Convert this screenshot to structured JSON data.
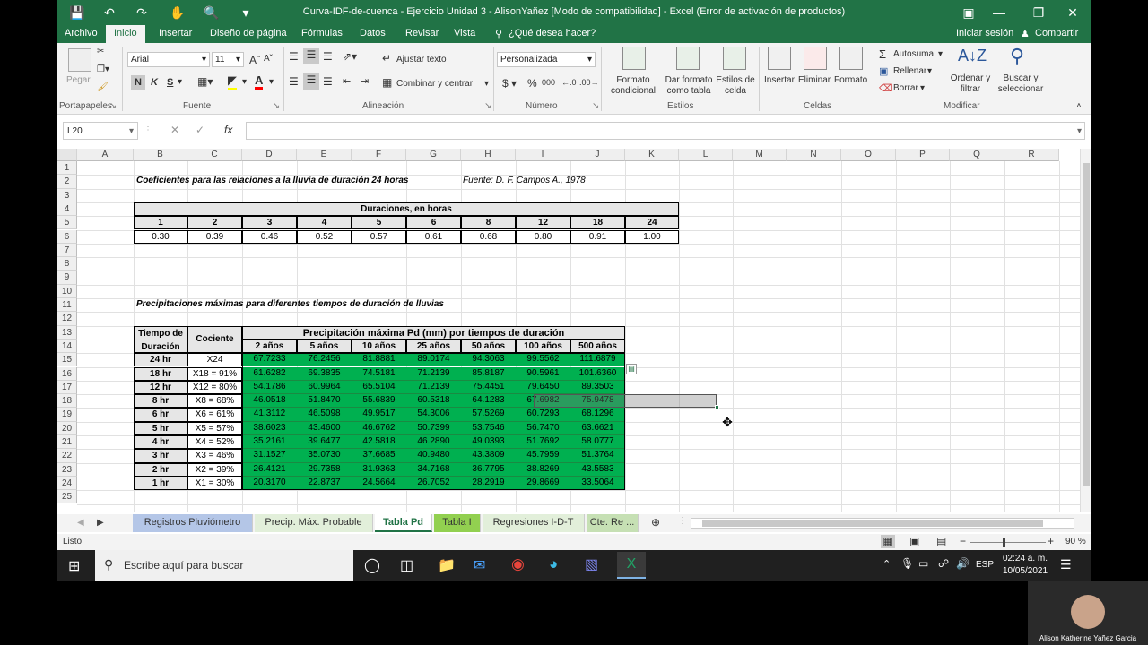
{
  "window": {
    "title": "Curva-IDF-de-cuenca - Ejercicio Unidad 3 - AlisonYañez  [Modo de compatibilidad] - Excel (Error de activación de productos)"
  },
  "ribbon_tabs": [
    "Archivo",
    "Inicio",
    "Insertar",
    "Diseño de página",
    "Fórmulas",
    "Datos",
    "Revisar",
    "Vista"
  ],
  "tell_me": "¿Qué desea hacer?",
  "account": {
    "signin": "Iniciar sesión",
    "share": "Compartir"
  },
  "ribbon": {
    "clipboard": {
      "paste": "Pegar",
      "label": "Portapapeles"
    },
    "font": {
      "name": "Arial",
      "size": "11",
      "bold": "N",
      "italic": "K",
      "underline": "S",
      "label": "Fuente"
    },
    "alignment": {
      "wrap": "Ajustar texto",
      "merge": "Combinar y centrar",
      "label": "Alineación"
    },
    "number": {
      "format": "Personalizada",
      "label": "Número"
    },
    "styles": {
      "conditional": "Formato condicional",
      "table": "Dar formato como tabla",
      "cell": "Estilos de celda",
      "label": "Estilos"
    },
    "cells": {
      "insert": "Insertar",
      "delete": "Eliminar",
      "format": "Formato",
      "label": "Celdas"
    },
    "editing": {
      "autosum": "Autosuma",
      "fill": "Rellenar",
      "clear": "Borrar",
      "sort": "Ordenar y filtrar",
      "find": "Buscar y seleccionar",
      "label": "Modificar"
    }
  },
  "namebox": "L20",
  "columns": [
    "A",
    "B",
    "C",
    "D",
    "E",
    "F",
    "G",
    "H",
    "I",
    "J",
    "K",
    "L",
    "M",
    "N",
    "O",
    "P",
    "Q",
    "R"
  ],
  "rows": [
    "1",
    "2",
    "3",
    "4",
    "5",
    "6",
    "7",
    "8",
    "9",
    "10",
    "11",
    "12",
    "13",
    "14",
    "15",
    "16",
    "17",
    "18",
    "19",
    "20",
    "21",
    "22",
    "23",
    "24",
    "25"
  ],
  "sheet": {
    "title1": "Coeficientes para las relaciones a la lluvia de duración 24 horas",
    "source": "Fuente: D. F. Campos A., 1978",
    "dur_header": "Duraciones, en horas",
    "durations": [
      "1",
      "2",
      "3",
      "4",
      "5",
      "6",
      "8",
      "12",
      "18",
      "24"
    ],
    "coefs": [
      "0.30",
      "0.39",
      "0.46",
      "0.52",
      "0.57",
      "0.61",
      "0.68",
      "0.80",
      "0.91",
      "1.00"
    ],
    "title2": "Precipitaciones máximas para diferentes tiempos de duración de lluvias",
    "h_tiempo": "Tiempo de Duración",
    "h_cociente": "Cociente",
    "h_precip": "Precipitación máxima Pd (mm) por tiempos de duración",
    "periods": [
      "2 años",
      "5 años",
      "10 años",
      "25 años",
      "50 años",
      "100 años",
      "500 años"
    ],
    "table": [
      {
        "t": "24 hr",
        "c": "X24",
        "v": [
          "67.7233",
          "76.2456",
          "81.8881",
          "89.0174",
          "94.3063",
          "99.5562",
          "111.6879"
        ]
      },
      {
        "t": "18 hr",
        "c": "X18 = 91%",
        "v": [
          "61.6282",
          "69.3835",
          "74.5181",
          "71.2139",
          "85.8187",
          "90.5961",
          "101.6360"
        ]
      },
      {
        "t": "12 hr",
        "c": "X12 = 80%",
        "v": [
          "54.1786",
          "60.9964",
          "65.5104",
          "71.2139",
          "75.4451",
          "79.6450",
          "89.3503"
        ]
      },
      {
        "t": "8 hr",
        "c": "X8 = 68%",
        "v": [
          "46.0518",
          "51.8470",
          "55.6839",
          "60.5318",
          "64.1283",
          "67.6982",
          "75.9478"
        ]
      },
      {
        "t": "6 hr",
        "c": "X6 = 61%",
        "v": [
          "41.3112",
          "46.5098",
          "49.9517",
          "54.3006",
          "57.5269",
          "60.7293",
          "68.1296"
        ]
      },
      {
        "t": "5 hr",
        "c": "X5 = 57%",
        "v": [
          "38.6023",
          "43.4600",
          "46.6762",
          "50.7399",
          "53.7546",
          "56.7470",
          "63.6621"
        ]
      },
      {
        "t": "4 hr",
        "c": "X4 = 52%",
        "v": [
          "35.2161",
          "39.6477",
          "42.5818",
          "46.2890",
          "49.0393",
          "51.7692",
          "58.0777"
        ]
      },
      {
        "t": "3 hr",
        "c": "X3 = 46%",
        "v": [
          "31.1527",
          "35.0730",
          "37.6685",
          "40.9480",
          "43.3809",
          "45.7959",
          "51.3764"
        ]
      },
      {
        "t": "2 hr",
        "c": "X2 = 39%",
        "v": [
          "26.4121",
          "29.7358",
          "31.9363",
          "34.7168",
          "36.7795",
          "38.8269",
          "43.5583"
        ]
      },
      {
        "t": "1 hr",
        "c": "X1 = 30%",
        "v": [
          "20.3170",
          "22.8737",
          "24.5664",
          "26.7052",
          "28.2919",
          "29.8669",
          "33.5064"
        ]
      }
    ]
  },
  "sheet_tabs": [
    {
      "name": "Registros Pluviómetro",
      "color": "#b4c6e7"
    },
    {
      "name": "Precip. Máx. Probable",
      "color": "#e2efda"
    },
    {
      "name": "Tabla Pd",
      "color": "#ffffff"
    },
    {
      "name": "Tabla I",
      "color": "#92d050"
    },
    {
      "name": "Regresiones I-D-T",
      "color": "#e2efda"
    },
    {
      "name": "Cte. Re ...",
      "color": "#c6e0b4"
    }
  ],
  "status": {
    "ready": "Listo",
    "zoom": "90 %"
  },
  "taskbar": {
    "search": "Escribe aquí para buscar",
    "lang": "ESP",
    "time": "02:24 a. m.",
    "date": "10/05/2021"
  },
  "webcam_name": "Alison Katherine Yañez Garcia",
  "colors": {
    "excel_green": "#217346",
    "cell_green": "#00b050"
  }
}
